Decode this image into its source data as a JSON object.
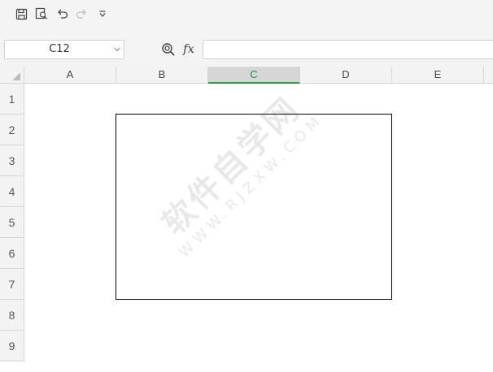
{
  "toolbar": {
    "icons": [
      "save-icon",
      "print-preview-icon",
      "undo-icon",
      "redo-icon",
      "customize-dropdown-icon"
    ]
  },
  "formula_bar": {
    "name_box": "C12",
    "fx_label": "fx",
    "formula_value": ""
  },
  "columns": [
    "A",
    "B",
    "C",
    "D",
    "E"
  ],
  "active_column": "C",
  "rows": [
    "1",
    "2",
    "3",
    "4",
    "5",
    "6",
    "7",
    "8",
    "9"
  ],
  "watermark": {
    "main": "软件自学网",
    "sub": "WWW.RJZXW.COM"
  },
  "colors": {
    "accent": "#2f9e44",
    "header_bg": "#f3f3f3",
    "active_header_bg": "#d6d6d6",
    "toolbar_bg": "#f4f4f4"
  }
}
